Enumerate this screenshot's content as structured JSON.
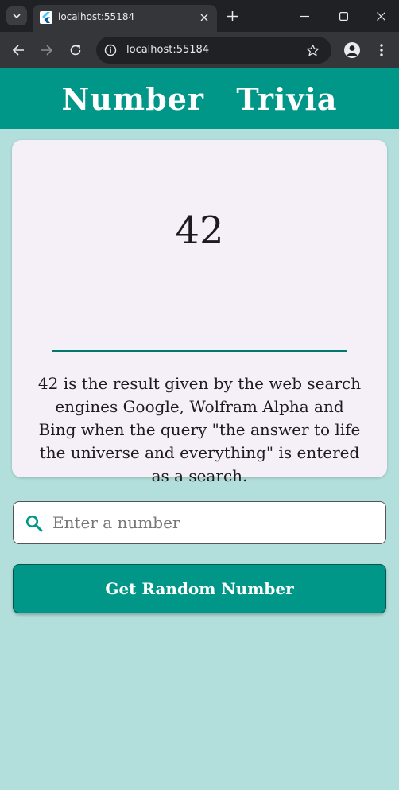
{
  "browser": {
    "tab_title": "localhost:55184",
    "url": "localhost:55184",
    "icons": {
      "tab_search": "chevron-down-icon",
      "favicon": "flutter-icon",
      "tab_close": "close-icon",
      "new_tab": "plus-icon",
      "minimize": "minimize-icon",
      "maximize": "maximize-icon",
      "close_window": "close-icon",
      "back": "arrow-left-icon",
      "forward": "arrow-right-icon",
      "reload": "reload-icon",
      "site_info": "info-icon",
      "bookmark": "star-icon",
      "profile": "person-icon",
      "menu": "more-vert-icon"
    }
  },
  "app": {
    "title": "Number  Trivia",
    "trivia": {
      "number": "42",
      "text_lines": [
        "42 is the result given by the web search",
        "engines Google, Wolfram Alpha and",
        "Bing when the query \"the answer to life",
        "the universe and everything\" is entered",
        "as a search."
      ]
    },
    "search": {
      "placeholder": "Enter a number",
      "value": "",
      "icon": "search-icon"
    },
    "random_button": {
      "label": "Get Random Number"
    },
    "colors": {
      "primary": "#009688",
      "background": "#b2dfdb",
      "card": "#f5f0f7",
      "divider": "#00796b"
    }
  }
}
